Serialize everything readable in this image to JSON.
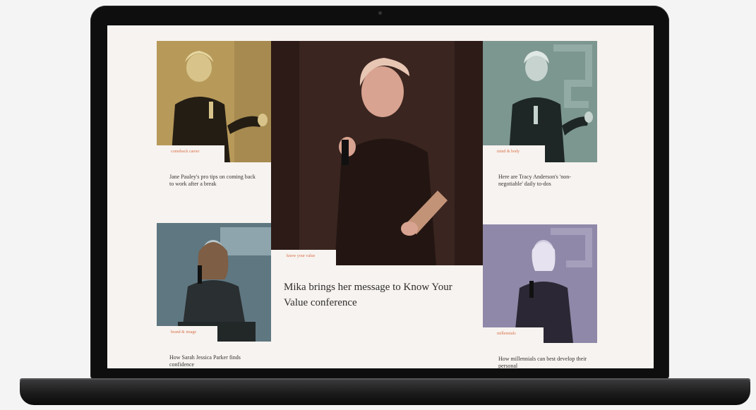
{
  "articles": {
    "top_left": {
      "tag": "comeback career",
      "headline": "Jane Pauley's pro tips on coming back to work after a break"
    },
    "top_right": {
      "tag": "mind & body",
      "headline": "Here are Tracy Anderson's 'non-negotiable' daily to-dos"
    },
    "center": {
      "tag": "know your value",
      "headline": "Mika brings her message to Know Your Value conference"
    },
    "bottom_left": {
      "tag": "brand & image",
      "headline": "How Sarah Jessica Parker finds confidence"
    },
    "bottom_right": {
      "tag": "millennials",
      "headline": "How millennials can best develop their personal"
    }
  },
  "colors": {
    "accent_tag": "#d9714a",
    "screen_bg": "#f7f3f0",
    "tint_gold": "#b79a5a",
    "tint_maroon": "#3a2520",
    "tint_sage": "#7c9690",
    "tint_slate": "#5f7781",
    "tint_lavender": "#8f88a8"
  }
}
